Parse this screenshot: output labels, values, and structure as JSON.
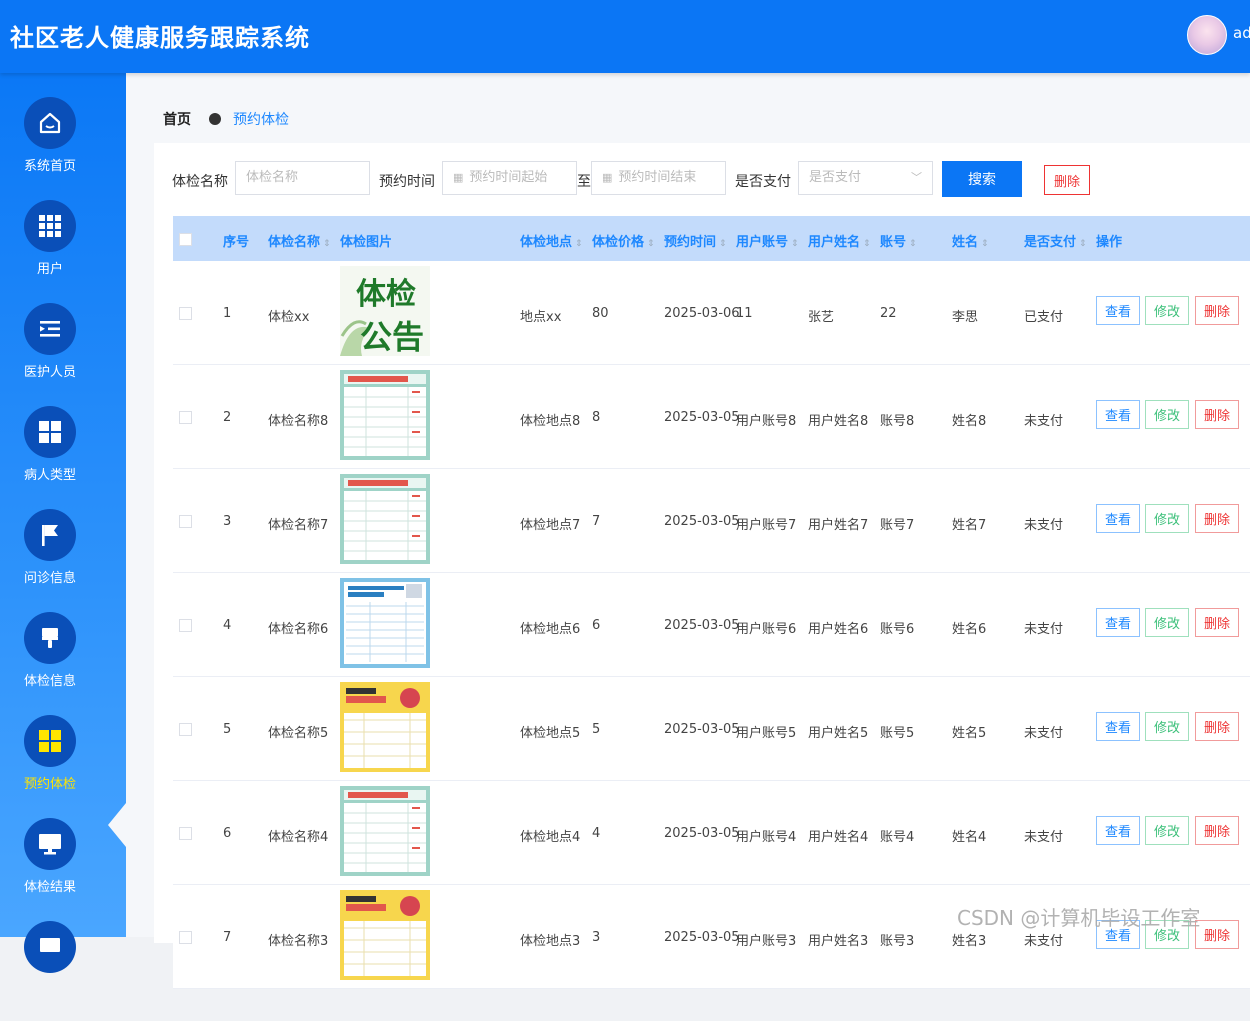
{
  "app": {
    "title": "社区老人健康服务跟踪系统",
    "username": "ad"
  },
  "sidebar": {
    "items": [
      {
        "label": "系统首页",
        "icon": "home-icon"
      },
      {
        "label": "用户",
        "icon": "grid-icon"
      },
      {
        "label": "医护人员",
        "icon": "list-indent-icon"
      },
      {
        "label": "病人类型",
        "icon": "four-squares-icon"
      },
      {
        "label": "问诊信息",
        "icon": "flag-icon"
      },
      {
        "label": "体检信息",
        "icon": "brush-icon"
      },
      {
        "label": "预约体检",
        "icon": "four-squares-icon",
        "active": true
      },
      {
        "label": "体检结果",
        "icon": "monitor-icon"
      }
    ]
  },
  "breadcrumb": {
    "home": "首页",
    "current": "预约体检"
  },
  "search": {
    "name_label": "体检名称",
    "name_placeholder": "体检名称",
    "time_label": "预约时间",
    "time_start_placeholder": "预约时间起始",
    "time_separator": "至",
    "time_end_placeholder": "预约时间结束",
    "paid_label": "是否支付",
    "paid_placeholder": "是否支付",
    "search_button": "搜索",
    "delete_button": "删除"
  },
  "table": {
    "columns": [
      "序号",
      "体检名称",
      "体检图片",
      "体检地点",
      "体检价格",
      "预约时间",
      "用户账号",
      "用户姓名",
      "账号",
      "姓名",
      "是否支付",
      "操作"
    ],
    "action_labels": {
      "view": "查看",
      "edit": "修改",
      "delete": "删除"
    },
    "rows": [
      {
        "index": "1",
        "name": "体检xx",
        "image": "poster-notice",
        "location": "地点xx",
        "price": "80",
        "time": "2025-03-06",
        "user_account": "11",
        "user_name": "张艺",
        "account": "22",
        "person": "李思",
        "paid": "已支付"
      },
      {
        "index": "2",
        "name": "体检名称8",
        "image": "poster-teal",
        "location": "体检地点8",
        "price": "8",
        "time": "2025-03-05",
        "user_account": "用户账号8",
        "user_name": "用户姓名8",
        "account": "账号8",
        "person": "姓名8",
        "paid": "未支付"
      },
      {
        "index": "3",
        "name": "体检名称7",
        "image": "poster-teal",
        "location": "体检地点7",
        "price": "7",
        "time": "2025-03-05",
        "user_account": "用户账号7",
        "user_name": "用户姓名7",
        "account": "账号7",
        "person": "姓名7",
        "paid": "未支付"
      },
      {
        "index": "4",
        "name": "体检名称6",
        "image": "poster-blue",
        "location": "体检地点6",
        "price": "6",
        "time": "2025-03-05",
        "user_account": "用户账号6",
        "user_name": "用户姓名6",
        "account": "账号6",
        "person": "姓名6",
        "paid": "未支付"
      },
      {
        "index": "5",
        "name": "体检名称5",
        "image": "poster-yellow",
        "location": "体检地点5",
        "price": "5",
        "time": "2025-03-05",
        "user_account": "用户账号5",
        "user_name": "用户姓名5",
        "account": "账号5",
        "person": "姓名5",
        "paid": "未支付"
      },
      {
        "index": "6",
        "name": "体检名称4",
        "image": "poster-teal",
        "location": "体检地点4",
        "price": "4",
        "time": "2025-03-05",
        "user_account": "用户账号4",
        "user_name": "用户姓名4",
        "account": "账号4",
        "person": "姓名4",
        "paid": "未支付"
      },
      {
        "index": "7",
        "name": "体检名称3",
        "image": "poster-yellow",
        "location": "体检地点3",
        "price": "3",
        "time": "2025-03-05",
        "user_account": "用户账号3",
        "user_name": "用户姓名3",
        "account": "账号3",
        "person": "姓名3",
        "paid": "未支付"
      }
    ]
  },
  "watermark": "CSDN @计算机毕设工作室",
  "colors": {
    "primary": "#0b76f5",
    "active_nav": "#ffe500",
    "danger": "#e33333",
    "success": "#3cc07a",
    "header_bg": "#c3dbfb"
  }
}
